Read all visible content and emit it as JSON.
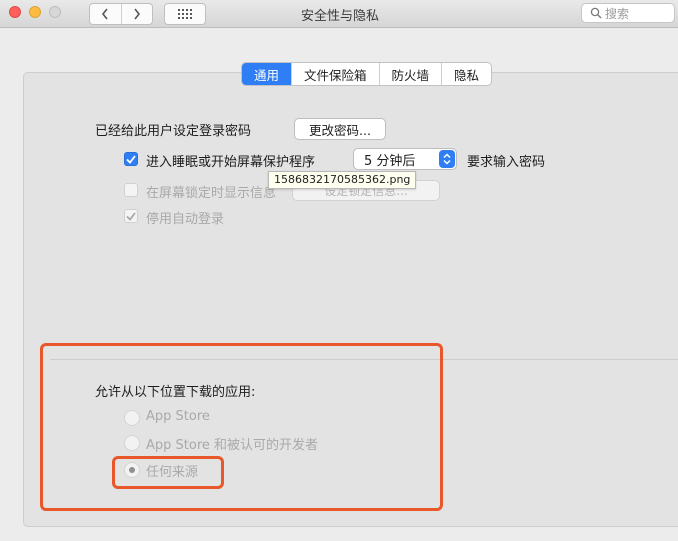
{
  "window": {
    "title": "安全性与隐私",
    "search_placeholder": "搜索",
    "nav_back_icon": "chevron-left-icon",
    "nav_forward_icon": "chevron-right-icon",
    "grid_icon": "grid-icon"
  },
  "tabs": [
    {
      "label": "通用",
      "active": true
    },
    {
      "label": "文件保险箱",
      "active": false
    },
    {
      "label": "防火墙",
      "active": false
    },
    {
      "label": "隐私",
      "active": false
    }
  ],
  "general": {
    "password_set_text": "已经给此用户设定登录密码",
    "change_password_button": "更改密码...",
    "sleep_checkbox_label": "进入睡眠或开始屏幕保护程序",
    "sleep_checkbox_checked": true,
    "sleep_delay_value": "5 分钟后",
    "require_password_text": "要求输入密码",
    "lock_message_label": "在屏幕锁定时显示信息",
    "lock_message_checked": false,
    "lock_message_button": "设定锁定信息...",
    "disable_autologin_label": "停用自动登录",
    "disable_autologin_checked": true,
    "tooltip_filename": "1586832170585362.png"
  },
  "downloads": {
    "heading": "允许从以下位置下载的应用:",
    "options": [
      {
        "label": "App Store",
        "selected": false
      },
      {
        "label": "App Store 和被认可的开发者",
        "selected": false
      },
      {
        "label": "任何来源",
        "selected": true
      }
    ]
  },
  "colors": {
    "accent": "#2f7ef6",
    "highlight": "#e8582b"
  }
}
